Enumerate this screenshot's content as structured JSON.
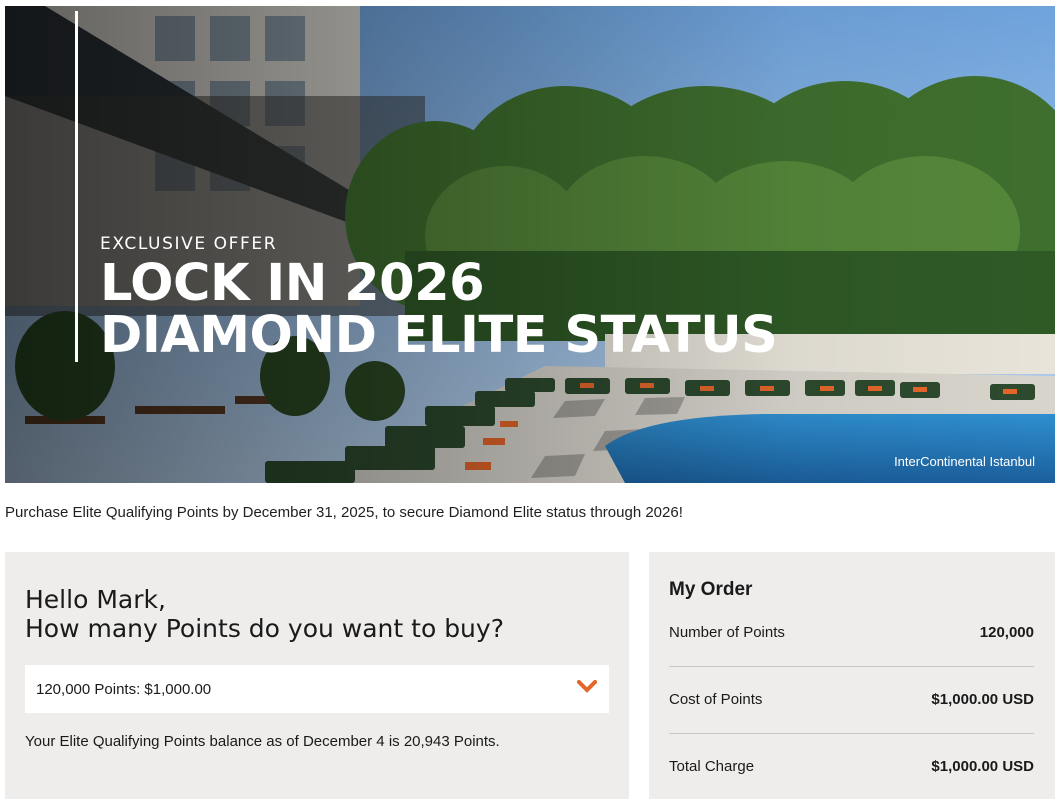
{
  "hero": {
    "eyebrow": "EXCLUSIVE OFFER",
    "headline_line1": "LOCK IN 2026",
    "headline_line2": "DIAMOND ELITE STATUS",
    "photo_caption": "InterContinental Istanbul"
  },
  "intro_text": "Purchase Elite Qualifying Points by December 31, 2025, to secure Diamond Elite status through 2026!",
  "purchase": {
    "greeting_line1": "Hello Mark,",
    "greeting_line2": "How many Points do you want to buy?",
    "selected_option": "120,000 Points: $1,000.00",
    "dropdown_icon": "chevron-down-icon",
    "balance_text": "Your Elite Qualifying Points balance as of December 4 is 20,943 Points."
  },
  "order": {
    "title": "My Order",
    "rows": [
      {
        "label": "Number of Points",
        "value": "120,000"
      },
      {
        "label": "Cost of Points",
        "value": "$1,000.00 USD"
      },
      {
        "label": "Total Charge",
        "value": "$1,000.00 USD"
      }
    ]
  },
  "colors": {
    "accent": "#e5662a",
    "panel_bg": "#eeedec"
  }
}
